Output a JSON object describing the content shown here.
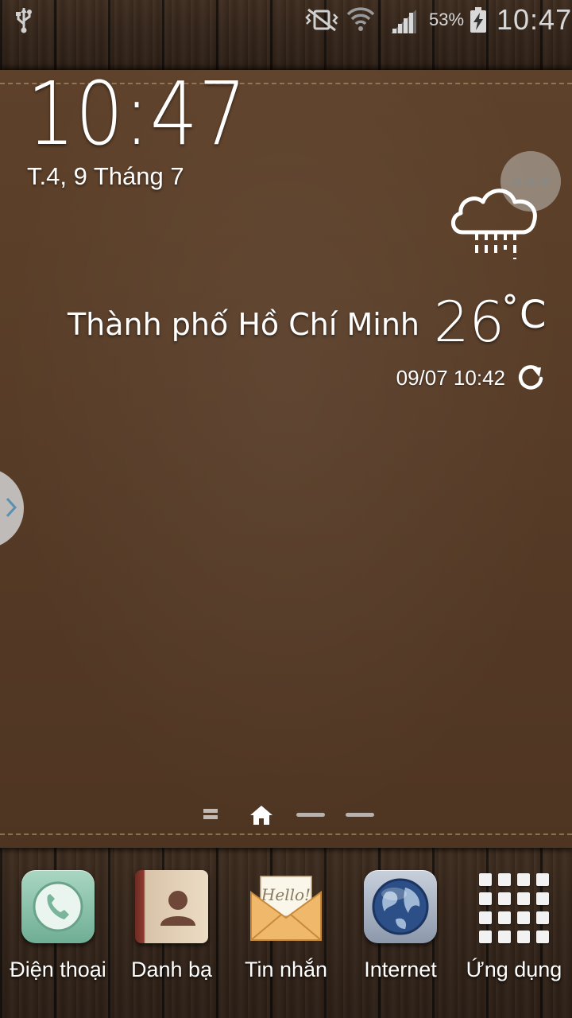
{
  "status_bar": {
    "battery_percent": "53%",
    "time": "10:47",
    "icons": [
      "usb-icon",
      "mute-vibrate-icon",
      "wifi-icon",
      "signal-icon",
      "battery-charging-icon"
    ]
  },
  "clock_widget": {
    "time": "10:47",
    "date": "T.4, 9 Tháng 7"
  },
  "weather_widget": {
    "city": "Thành phố Hồ Chí Minh",
    "temperature": "26",
    "unit": "˚C",
    "updated": "09/07 10:42",
    "condition_icon": "rain-cloud-icon"
  },
  "page_indicator": {
    "pages": [
      "grid",
      "home",
      "page",
      "page"
    ],
    "active": "home"
  },
  "dock": {
    "items": [
      {
        "label": "Điện thoại",
        "icon": "phone-icon"
      },
      {
        "label": "Danh bạ",
        "icon": "contacts-icon"
      },
      {
        "label": "Tin nhắn",
        "icon": "messages-icon",
        "icon_text": "Hello!"
      },
      {
        "label": "Internet",
        "icon": "globe-icon"
      },
      {
        "label": "Ứng dụng",
        "icon": "apps-grid-icon"
      }
    ]
  },
  "colors": {
    "leather": "#573c27",
    "wood": "#332419",
    "text": "#ffffff"
  }
}
